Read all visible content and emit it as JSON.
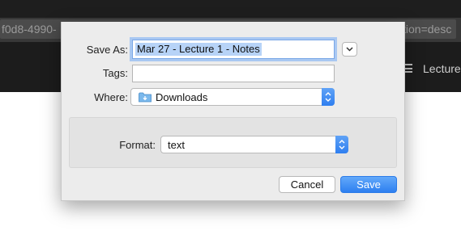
{
  "background": {
    "url_fragment_left": "f0d8-4990-",
    "url_fragment_right": "tion=desc",
    "nav_label": "Lecture"
  },
  "dialog": {
    "save_as_label": "Save As:",
    "save_as_value": "Mar 27 - Lecture 1 - Notes",
    "tags_label": "Tags:",
    "tags_value": "",
    "where_label": "Where:",
    "where_value": "Downloads",
    "format_label": "Format:",
    "format_value": "text",
    "cancel_label": "Cancel",
    "save_label": "Save"
  },
  "colors": {
    "accent": "#2f7ff0",
    "selection": "#b7d3f7",
    "dialog_bg": "#ececec"
  },
  "icons": {
    "expand": "chevron-down-icon",
    "folder": "downloads-folder-icon",
    "stepper": "up-down-arrows-icon",
    "menu": "hamburger-menu-icon"
  }
}
